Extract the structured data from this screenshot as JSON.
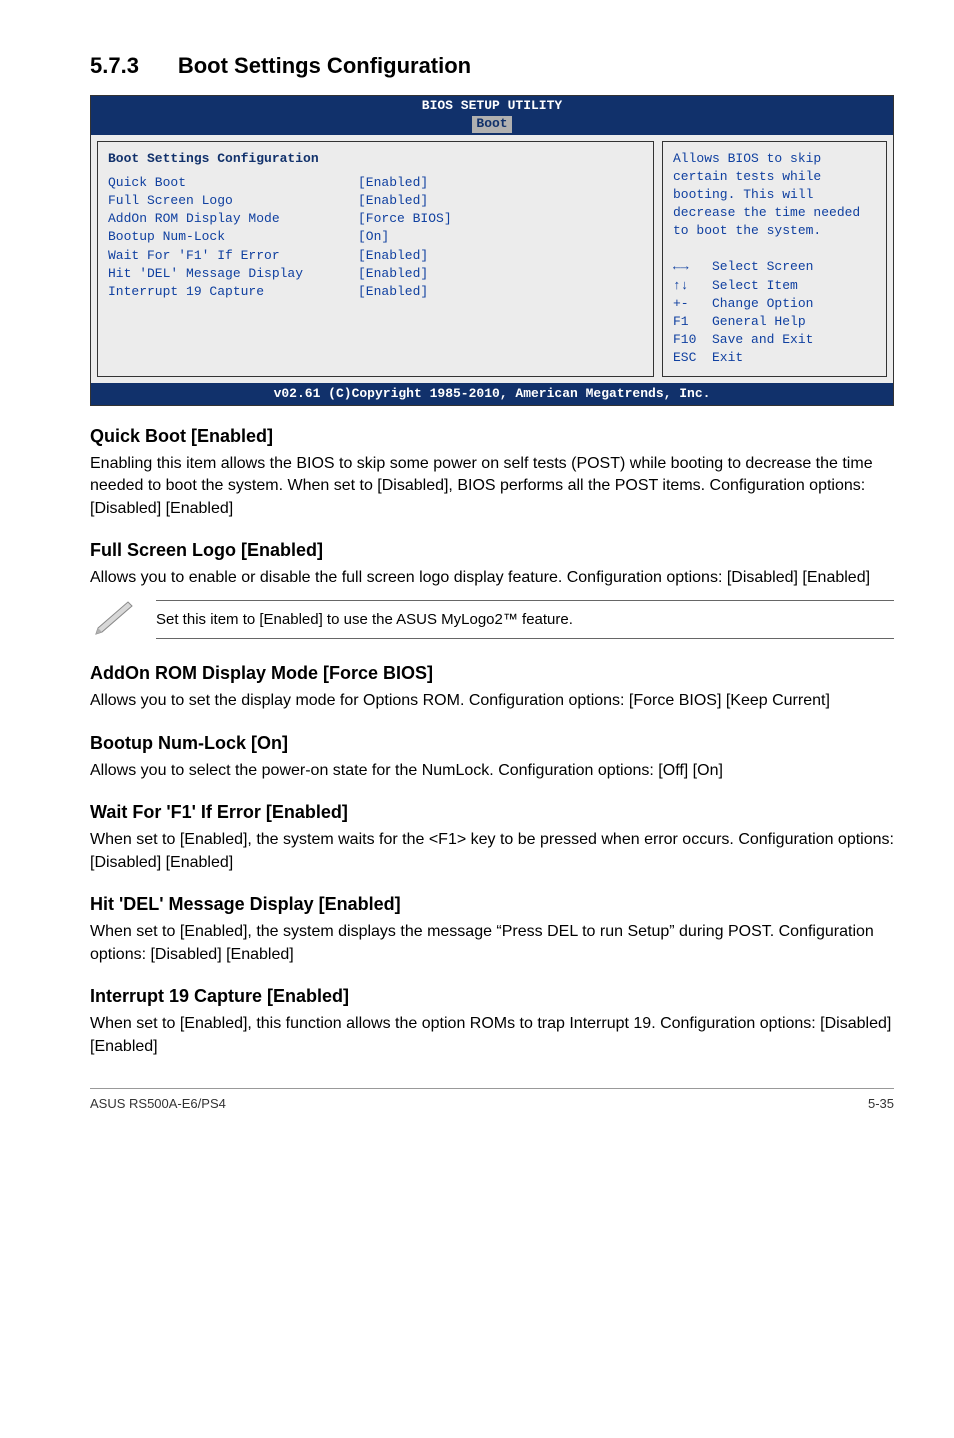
{
  "section": {
    "number": "5.7.3",
    "title": "Boot Settings Configuration"
  },
  "bios": {
    "header_line1": "BIOS SETUP UTILITY",
    "header_tab": "Boot",
    "panel_heading": "Boot Settings Configuration",
    "rows": [
      {
        "label": "Quick Boot",
        "value": "[Enabled]"
      },
      {
        "label": "Full Screen Logo",
        "value": "[Enabled]"
      },
      {
        "label": "AddOn ROM Display Mode",
        "value": "[Force BIOS]"
      },
      {
        "label": "Bootup Num-Lock",
        "value": "[On]"
      },
      {
        "label": "Wait For 'F1' If Error",
        "value": "[Enabled]"
      },
      {
        "label": "Hit 'DEL' Message Display",
        "value": "[Enabled]"
      },
      {
        "label": "Interrupt 19 Capture",
        "value": "[Enabled]"
      }
    ],
    "help_text": "Allows BIOS to skip certain tests while booting. This will decrease the time needed to boot the system.",
    "nav": [
      "←→   Select Screen",
      "↑↓   Select Item",
      "+-   Change Option",
      "F1   General Help",
      "F10  Save and Exit",
      "ESC  Exit"
    ],
    "footer": "v02.61 (C)Copyright 1985-2010, American Megatrends, Inc."
  },
  "items": [
    {
      "heading": "Quick Boot [Enabled]",
      "body": "Enabling this item allows the BIOS to skip some power on self tests (POST) while booting to decrease the time needed to boot the system. When set to [Disabled], BIOS performs all the POST items. Configuration options: [Disabled] [Enabled]"
    },
    {
      "heading": "Full Screen Logo [Enabled]",
      "body": "Allows you to enable or disable the full screen logo display feature. Configuration options: [Disabled] [Enabled]",
      "note": "Set this item to [Enabled] to use the ASUS MyLogo2™ feature."
    },
    {
      "heading": "AddOn ROM Display Mode [Force BIOS]",
      "body": "Allows you to set the display mode for Options ROM. Configuration options: [Force BIOS] [Keep Current]"
    },
    {
      "heading": "Bootup Num-Lock [On]",
      "body": "Allows you to select the power-on state for the NumLock. Configuration options: [Off] [On]"
    },
    {
      "heading": "Wait For 'F1' If Error [Enabled]",
      "body": "When set to [Enabled], the system waits for the <F1> key to be pressed when error occurs. Configuration options: [Disabled] [Enabled]"
    },
    {
      "heading": "Hit 'DEL' Message Display [Enabled]",
      "body": "When set to [Enabled], the system displays the message “Press DEL to run Setup” during POST. Configuration options: [Disabled] [Enabled]"
    },
    {
      "heading": "Interrupt 19 Capture [Enabled]",
      "body": "When set to [Enabled], this function allows the option ROMs to trap Interrupt 19. Configuration options: [Disabled] [Enabled]"
    }
  ],
  "footer": {
    "left": "ASUS RS500A-E6/PS4",
    "right": "5-35"
  }
}
